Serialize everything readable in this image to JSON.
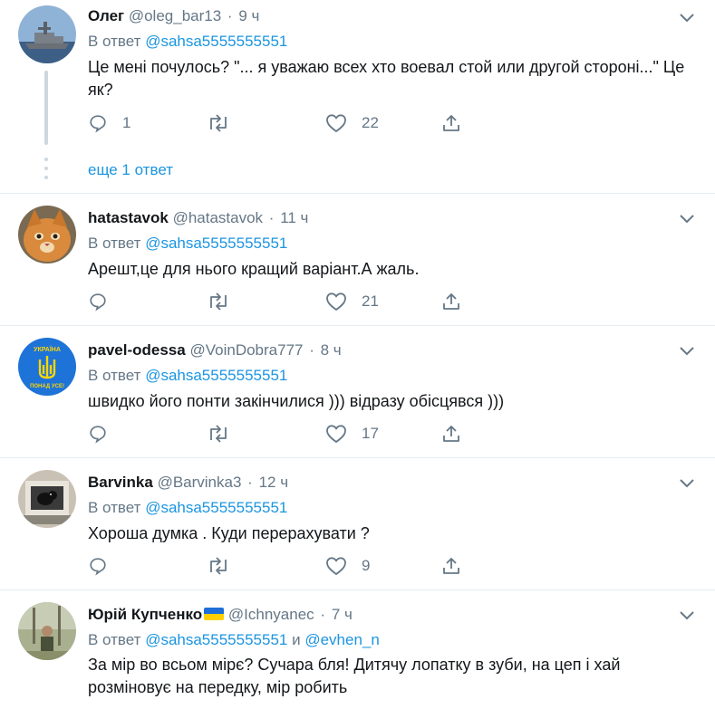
{
  "colors": {
    "link": "#1b95e0",
    "secondary": "#657786",
    "text": "#14171a",
    "border": "#e6ecf0",
    "thread": "#cdd7df"
  },
  "icons": {
    "reply": "reply-icon",
    "retweet": "retweet-icon",
    "like": "heart-icon",
    "share": "share-icon",
    "menu": "chevron-down-icon"
  },
  "tweets": [
    {
      "name": "Олег",
      "handle": "@oleg_bar13",
      "time": "9 ч",
      "reply_prefix": "В ответ",
      "reply_to": "@sahsa5555555551",
      "text": "Це мені почулось? \"... я уважаю всех хто воевал стой или другой стороні...\" Це як?",
      "replies": "1",
      "retweets": "",
      "likes": "22",
      "more_replies": "еще 1 ответ"
    },
    {
      "name": "hatastavok",
      "handle": "@hatastavok",
      "time": "11 ч",
      "reply_prefix": "В ответ",
      "reply_to": "@sahsa5555555551",
      "text": "Арешт,це для нього кращий варіант.А жаль.",
      "replies": "",
      "retweets": "",
      "likes": "21"
    },
    {
      "name": "pavel-odessa",
      "handle": "@VoinDobra777",
      "time": "8 ч",
      "reply_prefix": "В ответ",
      "reply_to": "@sahsa5555555551",
      "text": "швидко його понти закінчилися ))) відразу обісцявся )))",
      "replies": "",
      "retweets": "",
      "likes": "17",
      "avatar_text_top": "УКРАЇНА",
      "avatar_text_bottom": "ПОНАД УСЕ!"
    },
    {
      "name": "Barvinka",
      "handle": "@Barvinka3",
      "time": "12 ч",
      "reply_prefix": "В ответ",
      "reply_to": "@sahsa5555555551",
      "text": "Хороша думка . Куди перерахувати ?",
      "replies": "",
      "retweets": "",
      "likes": "9"
    },
    {
      "name": "Юрій Купченко",
      "handle": "@Ichnyanec",
      "time": "7 ч",
      "reply_prefix": "В ответ",
      "reply_to": "@sahsa5555555551",
      "reply_and": "и",
      "reply_to_2": "@evhen_n",
      "text": "За мір во всьом мірє? Сучара бля! Дитячу лопатку в зуби, на цеп і хай розміновує на передку, мір робить",
      "replies": "",
      "retweets": "",
      "likes": ""
    }
  ]
}
